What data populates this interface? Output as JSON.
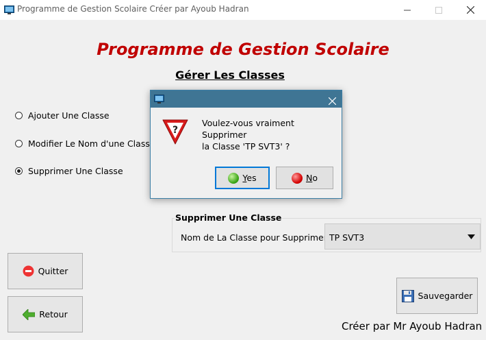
{
  "window": {
    "title": "Programme de Gestion Scolaire Créer par Ayoub Hadran",
    "icon": "computer-monitor-icon",
    "controls": [
      "minimize-icon",
      "maximize-icon",
      "close-icon"
    ]
  },
  "header": {
    "app_title": "Programme de Gestion Scolaire",
    "section_title": "Gérer Les Classes"
  },
  "options": [
    {
      "label": "Ajouter Une Classe",
      "selected": false
    },
    {
      "label": "Modifier Le Nom d'une Classe",
      "selected": false
    },
    {
      "label": "Supprimer Une Classe",
      "selected": true
    }
  ],
  "delete_panel": {
    "title": "Supprimer Une Classe",
    "field_label": "Nom de La Classe pour Supprimer  :",
    "selected_value": "TP SVT3"
  },
  "buttons": {
    "quit": "Quitter",
    "back": "Retour",
    "save": "Sauvegarder"
  },
  "footer": {
    "credit": "Créer par Mr Ayoub Hadran"
  },
  "dialog": {
    "icon": "warning-icon",
    "message": "Voulez-vous vraiment Supprimer\nla Classe 'TP SVT3' ?",
    "yes_label": "Yes",
    "no_label": "No"
  },
  "colors": {
    "app_title": "#c00000",
    "dialog_titlebar": "#3f7594",
    "focus_border": "#0078d7"
  }
}
